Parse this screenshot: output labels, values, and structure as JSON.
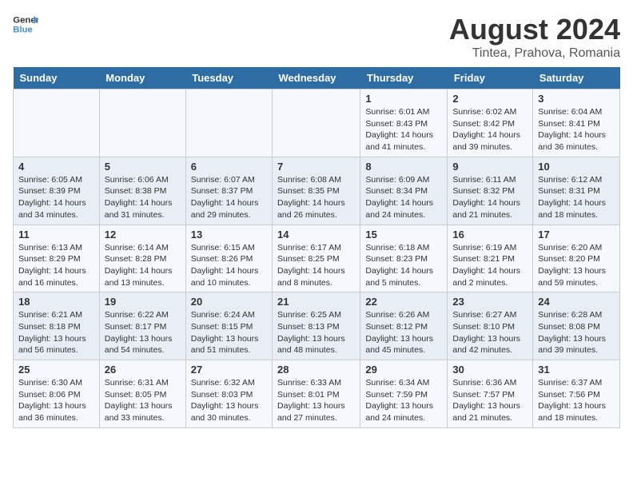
{
  "header": {
    "logo_text_general": "General",
    "logo_text_blue": "Blue",
    "main_title": "August 2024",
    "subtitle": "Tintea, Prahova, Romania"
  },
  "weekdays": [
    "Sunday",
    "Monday",
    "Tuesday",
    "Wednesday",
    "Thursday",
    "Friday",
    "Saturday"
  ],
  "weeks": [
    [
      {
        "day": "",
        "info": ""
      },
      {
        "day": "",
        "info": ""
      },
      {
        "day": "",
        "info": ""
      },
      {
        "day": "",
        "info": ""
      },
      {
        "day": "1",
        "info": "Sunrise: 6:01 AM\nSunset: 8:43 PM\nDaylight: 14 hours\nand 41 minutes."
      },
      {
        "day": "2",
        "info": "Sunrise: 6:02 AM\nSunset: 8:42 PM\nDaylight: 14 hours\nand 39 minutes."
      },
      {
        "day": "3",
        "info": "Sunrise: 6:04 AM\nSunset: 8:41 PM\nDaylight: 14 hours\nand 36 minutes."
      }
    ],
    [
      {
        "day": "4",
        "info": "Sunrise: 6:05 AM\nSunset: 8:39 PM\nDaylight: 14 hours\nand 34 minutes."
      },
      {
        "day": "5",
        "info": "Sunrise: 6:06 AM\nSunset: 8:38 PM\nDaylight: 14 hours\nand 31 minutes."
      },
      {
        "day": "6",
        "info": "Sunrise: 6:07 AM\nSunset: 8:37 PM\nDaylight: 14 hours\nand 29 minutes."
      },
      {
        "day": "7",
        "info": "Sunrise: 6:08 AM\nSunset: 8:35 PM\nDaylight: 14 hours\nand 26 minutes."
      },
      {
        "day": "8",
        "info": "Sunrise: 6:09 AM\nSunset: 8:34 PM\nDaylight: 14 hours\nand 24 minutes."
      },
      {
        "day": "9",
        "info": "Sunrise: 6:11 AM\nSunset: 8:32 PM\nDaylight: 14 hours\nand 21 minutes."
      },
      {
        "day": "10",
        "info": "Sunrise: 6:12 AM\nSunset: 8:31 PM\nDaylight: 14 hours\nand 18 minutes."
      }
    ],
    [
      {
        "day": "11",
        "info": "Sunrise: 6:13 AM\nSunset: 8:29 PM\nDaylight: 14 hours\nand 16 minutes."
      },
      {
        "day": "12",
        "info": "Sunrise: 6:14 AM\nSunset: 8:28 PM\nDaylight: 14 hours\nand 13 minutes."
      },
      {
        "day": "13",
        "info": "Sunrise: 6:15 AM\nSunset: 8:26 PM\nDaylight: 14 hours\nand 10 minutes."
      },
      {
        "day": "14",
        "info": "Sunrise: 6:17 AM\nSunset: 8:25 PM\nDaylight: 14 hours\nand 8 minutes."
      },
      {
        "day": "15",
        "info": "Sunrise: 6:18 AM\nSunset: 8:23 PM\nDaylight: 14 hours\nand 5 minutes."
      },
      {
        "day": "16",
        "info": "Sunrise: 6:19 AM\nSunset: 8:21 PM\nDaylight: 14 hours\nand 2 minutes."
      },
      {
        "day": "17",
        "info": "Sunrise: 6:20 AM\nSunset: 8:20 PM\nDaylight: 13 hours\nand 59 minutes."
      }
    ],
    [
      {
        "day": "18",
        "info": "Sunrise: 6:21 AM\nSunset: 8:18 PM\nDaylight: 13 hours\nand 56 minutes."
      },
      {
        "day": "19",
        "info": "Sunrise: 6:22 AM\nSunset: 8:17 PM\nDaylight: 13 hours\nand 54 minutes."
      },
      {
        "day": "20",
        "info": "Sunrise: 6:24 AM\nSunset: 8:15 PM\nDaylight: 13 hours\nand 51 minutes."
      },
      {
        "day": "21",
        "info": "Sunrise: 6:25 AM\nSunset: 8:13 PM\nDaylight: 13 hours\nand 48 minutes."
      },
      {
        "day": "22",
        "info": "Sunrise: 6:26 AM\nSunset: 8:12 PM\nDaylight: 13 hours\nand 45 minutes."
      },
      {
        "day": "23",
        "info": "Sunrise: 6:27 AM\nSunset: 8:10 PM\nDaylight: 13 hours\nand 42 minutes."
      },
      {
        "day": "24",
        "info": "Sunrise: 6:28 AM\nSunset: 8:08 PM\nDaylight: 13 hours\nand 39 minutes."
      }
    ],
    [
      {
        "day": "25",
        "info": "Sunrise: 6:30 AM\nSunset: 8:06 PM\nDaylight: 13 hours\nand 36 minutes."
      },
      {
        "day": "26",
        "info": "Sunrise: 6:31 AM\nSunset: 8:05 PM\nDaylight: 13 hours\nand 33 minutes."
      },
      {
        "day": "27",
        "info": "Sunrise: 6:32 AM\nSunset: 8:03 PM\nDaylight: 13 hours\nand 30 minutes."
      },
      {
        "day": "28",
        "info": "Sunrise: 6:33 AM\nSunset: 8:01 PM\nDaylight: 13 hours\nand 27 minutes."
      },
      {
        "day": "29",
        "info": "Sunrise: 6:34 AM\nSunset: 7:59 PM\nDaylight: 13 hours\nand 24 minutes."
      },
      {
        "day": "30",
        "info": "Sunrise: 6:36 AM\nSunset: 7:57 PM\nDaylight: 13 hours\nand 21 minutes."
      },
      {
        "day": "31",
        "info": "Sunrise: 6:37 AM\nSunset: 7:56 PM\nDaylight: 13 hours\nand 18 minutes."
      }
    ]
  ]
}
